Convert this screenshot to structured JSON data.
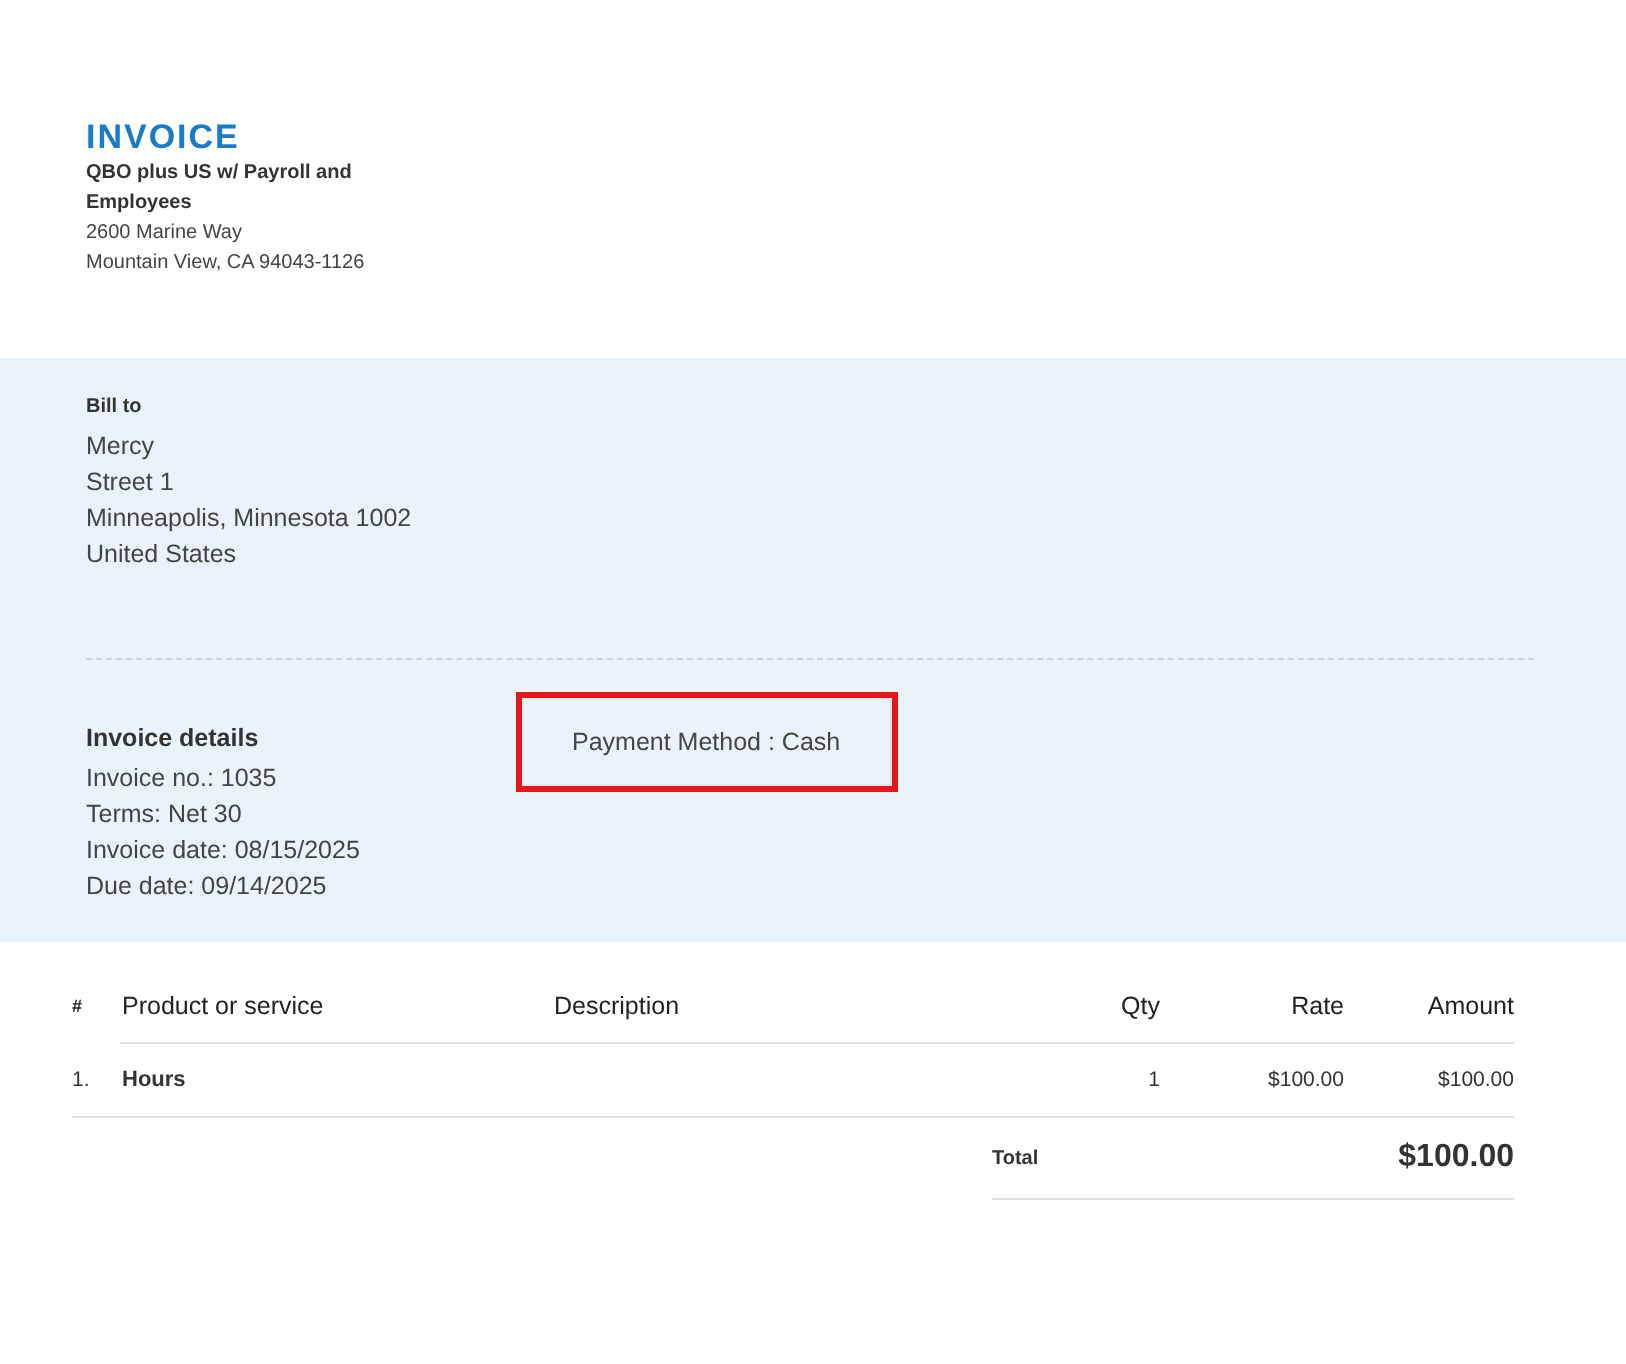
{
  "header": {
    "title": "INVOICE",
    "company_lines": [
      "QBO plus US w/ Payroll and",
      "Employees"
    ],
    "address_lines": [
      "2600 Marine Way",
      "Mountain View, CA 94043-1126"
    ]
  },
  "bill_to": {
    "heading": "Bill to",
    "lines": [
      "Mercy",
      "Street 1",
      "Minneapolis, Minnesota 1002",
      "United States"
    ]
  },
  "details": {
    "heading": "Invoice details",
    "lines": [
      "Invoice no.: 1035",
      "Terms: Net 30",
      "Invoice date: 08/15/2025",
      "Due date: 09/14/2025"
    ]
  },
  "payment_method": {
    "text": "Payment Method : Cash",
    "highlighted": true
  },
  "table": {
    "columns": [
      "#",
      "Product or service",
      "Description",
      "Qty",
      "Rate",
      "Amount"
    ],
    "rows": [
      {
        "number": "1.",
        "product": "Hours",
        "qty": "1",
        "rate": "$100.00",
        "amount": "$100.00"
      }
    ]
  },
  "total": {
    "label": "Total",
    "value": "$100.00"
  }
}
